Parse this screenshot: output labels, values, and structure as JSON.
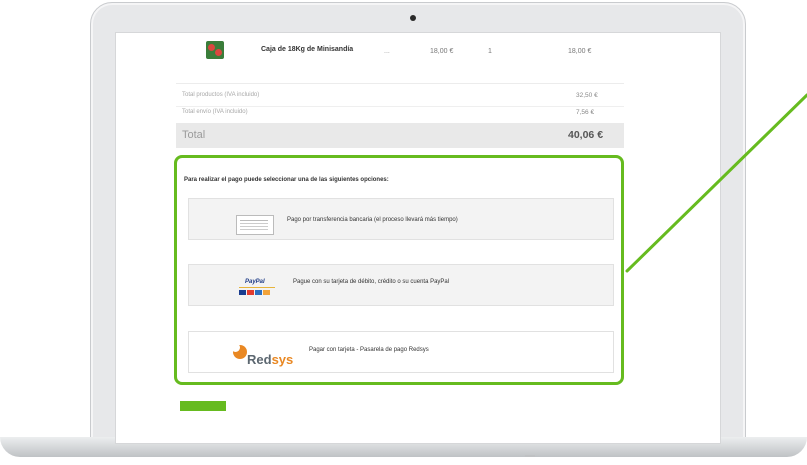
{
  "product": {
    "name": "Caja de 18Kg de Minisandía",
    "dash": "...",
    "unit_price": "18,00 €",
    "quantity": "1",
    "line_total": "18,00 €"
  },
  "summary": {
    "products_label": "Total productos (IVA incluido)",
    "products_value": "32,50 €",
    "shipping_label": "Total envío (IVA incluido)",
    "shipping_value": "7,56 €",
    "total_label": "Total",
    "total_value": "40,06 €"
  },
  "payment": {
    "intro": "Para realizar el pago puede seleccionar una de las siguientes opciones:",
    "options": [
      {
        "label": "Pago por transferencia bancaria (el proceso llevará más tiempo)",
        "icon": "bank-transfer-icon"
      },
      {
        "label": "Pague con su tarjeta de débito, crédito o su cuenta PayPal",
        "icon": "paypal-icon",
        "logo_text": "PayPal"
      },
      {
        "label": "Pagar con tarjeta - Pasarela de pago Redsys",
        "icon": "redsys-icon",
        "logo_text": "Redsys"
      }
    ]
  },
  "colors": {
    "accent": "#66bb1f",
    "total_bg": "#e9e9e9",
    "option_bg": "#f3f3f3",
    "redsys_orange": "#e98823",
    "paypal_blue": "#1f3c87"
  }
}
